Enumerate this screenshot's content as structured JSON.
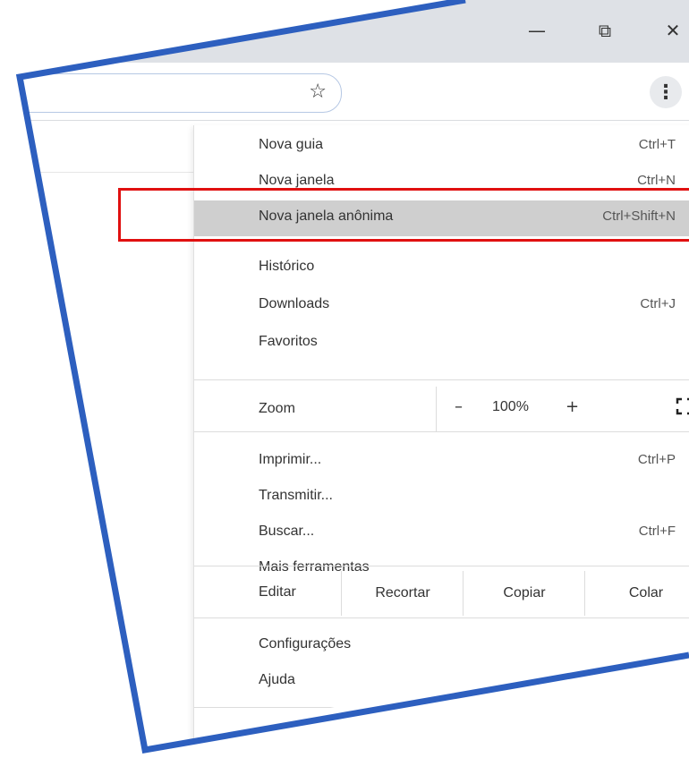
{
  "window": {
    "minimize_icon": "minimize-icon",
    "restore_icon": "restore-icon",
    "close_icon": "close-icon"
  },
  "toolbar": {
    "bookmark_icon": "star-icon",
    "menu_icon": "three-dots-vertical-icon"
  },
  "menu": {
    "items": [
      {
        "label": "Nova guia",
        "shortcut": "Ctrl+T"
      },
      {
        "label": "Nova janela",
        "shortcut": "Ctrl+N"
      },
      {
        "label": "Nova janela anônima",
        "shortcut": "Ctrl+Shift+N"
      },
      {
        "label": "Histórico",
        "shortcut": ""
      },
      {
        "label": "Downloads",
        "shortcut": "Ctrl+J"
      },
      {
        "label": "Favoritos",
        "shortcut": ""
      },
      {
        "label": "Imprimir...",
        "shortcut": "Ctrl+P"
      },
      {
        "label": "Transmitir...",
        "shortcut": ""
      },
      {
        "label": "Buscar...",
        "shortcut": "Ctrl+F"
      },
      {
        "label": "Mais ferramentas",
        "shortcut": ""
      },
      {
        "label": "Configurações",
        "shortcut": ""
      },
      {
        "label": "Ajuda",
        "shortcut": ""
      }
    ],
    "zoom": {
      "label": "Zoom",
      "minus": "–",
      "value": "100%",
      "plus": "+"
    },
    "edit": {
      "label": "Editar",
      "cut": "Recortar",
      "copy": "Copiar",
      "paste": "Colar"
    }
  },
  "colors": {
    "highlight": "#cfcfcf",
    "red_box": "#e01010",
    "frame_blue": "#2d5fbf",
    "titlebar": "#dee1e6"
  }
}
